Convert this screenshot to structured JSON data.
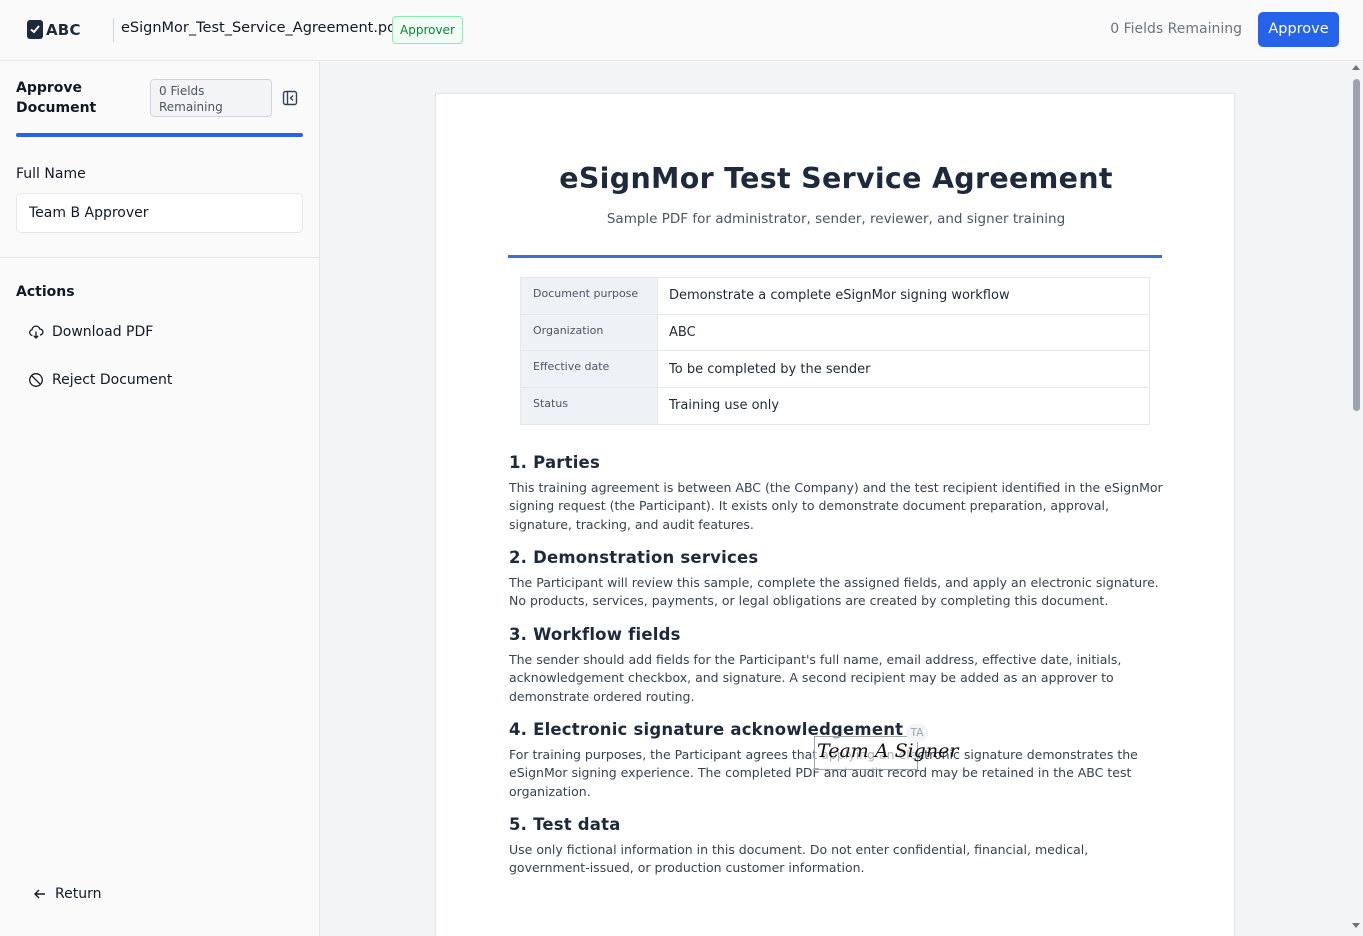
{
  "header": {
    "logo_text": "ABC",
    "document_name": "eSignMor_Test_Service_Agreement.pdf",
    "role_badge": "Approver",
    "fields_remaining": "0 Fields Remaining",
    "approve_label": "Approve"
  },
  "sidebar": {
    "title": "Approve Document",
    "fields_remaining": "0 Fields Remaining",
    "full_name_label": "Full Name",
    "full_name_value": "Team B Approver",
    "actions_title": "Actions",
    "actions": [
      {
        "label": "Download PDF",
        "icon": "cloud-download-icon"
      },
      {
        "label": "Reject Document",
        "icon": "ban-icon"
      }
    ],
    "return_label": "Return"
  },
  "document": {
    "title": "eSignMor Test Service Agreement",
    "subtitle": "Sample PDF for administrator, sender, reviewer, and signer training",
    "info": [
      {
        "key": "Document purpose",
        "value": "Demonstrate a complete eSignMor signing workflow"
      },
      {
        "key": "Organization",
        "value": "ABC"
      },
      {
        "key": "Effective date",
        "value": "To be completed by the sender"
      },
      {
        "key": "Status",
        "value": "Training use only"
      }
    ],
    "sections": [
      {
        "heading": "1. Parties",
        "body": "This training agreement is between ABC (the Company) and the test recipient identified in the eSignMor signing request (the Participant). It exists only to demonstrate document preparation, approval, signature, tracking, and audit features."
      },
      {
        "heading": "2. Demonstration services",
        "body": "The Participant will review this sample, complete the assigned fields, and apply an electronic signature. No products, services, payments, or legal obligations are created by completing this document."
      },
      {
        "heading": "3. Workflow fields",
        "body": "The sender should add fields for the Participant's full name, email address, effective date, initials, acknowledgement checkbox, and signature. A second recipient may be added as an approver to demonstrate ordered routing."
      },
      {
        "heading": "4. Electronic signature acknowledgement",
        "body": "For training purposes, the Participant agrees that applying an electronic signature demonstrates the eSignMor signing experience. The completed PDF and audit record may be retained in the ABC test organization."
      },
      {
        "heading": "5. Test data",
        "body": "Use only fictional information in this document. Do not enter confidential, financial, medical, government-issued, or production customer information."
      }
    ],
    "signature": {
      "text": "Team A Signer",
      "badge": "TA"
    }
  },
  "colors": {
    "accent": "#2563eb",
    "badge_green": "#15803d"
  }
}
